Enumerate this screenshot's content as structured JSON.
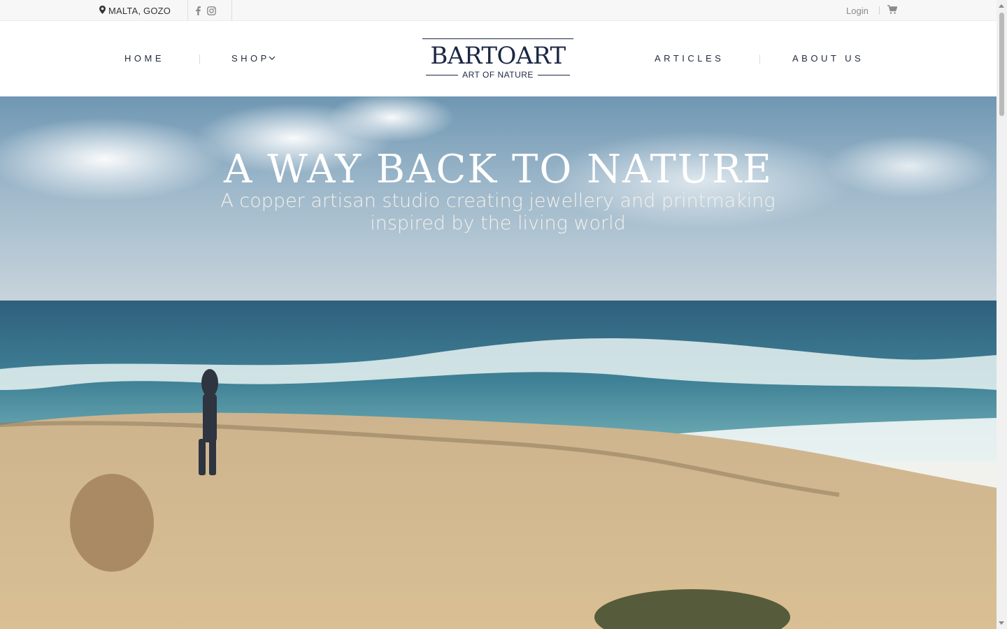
{
  "topbar": {
    "location": "MALTA, GOZO",
    "location_icon": "map-pin-icon",
    "social": [
      "facebook-icon",
      "instagram-icon"
    ],
    "login_label": "Login",
    "cart_icon": "cart-icon"
  },
  "nav": {
    "home": "HOME",
    "shop": "SHOP",
    "articles": "ARTICLES",
    "about": "ABOUT US"
  },
  "logo": {
    "name": "BARTOART",
    "tagline": "ART OF NATURE"
  },
  "hero": {
    "title": "A WAY BACK TO NATURE",
    "subtitle_line1": "A copper artisan studio creating jewellery and printmaking",
    "subtitle_line2": "inspired by the living world"
  },
  "colors": {
    "brand_navy": "#1a2744",
    "topbar_bg": "#f7f7f7"
  }
}
